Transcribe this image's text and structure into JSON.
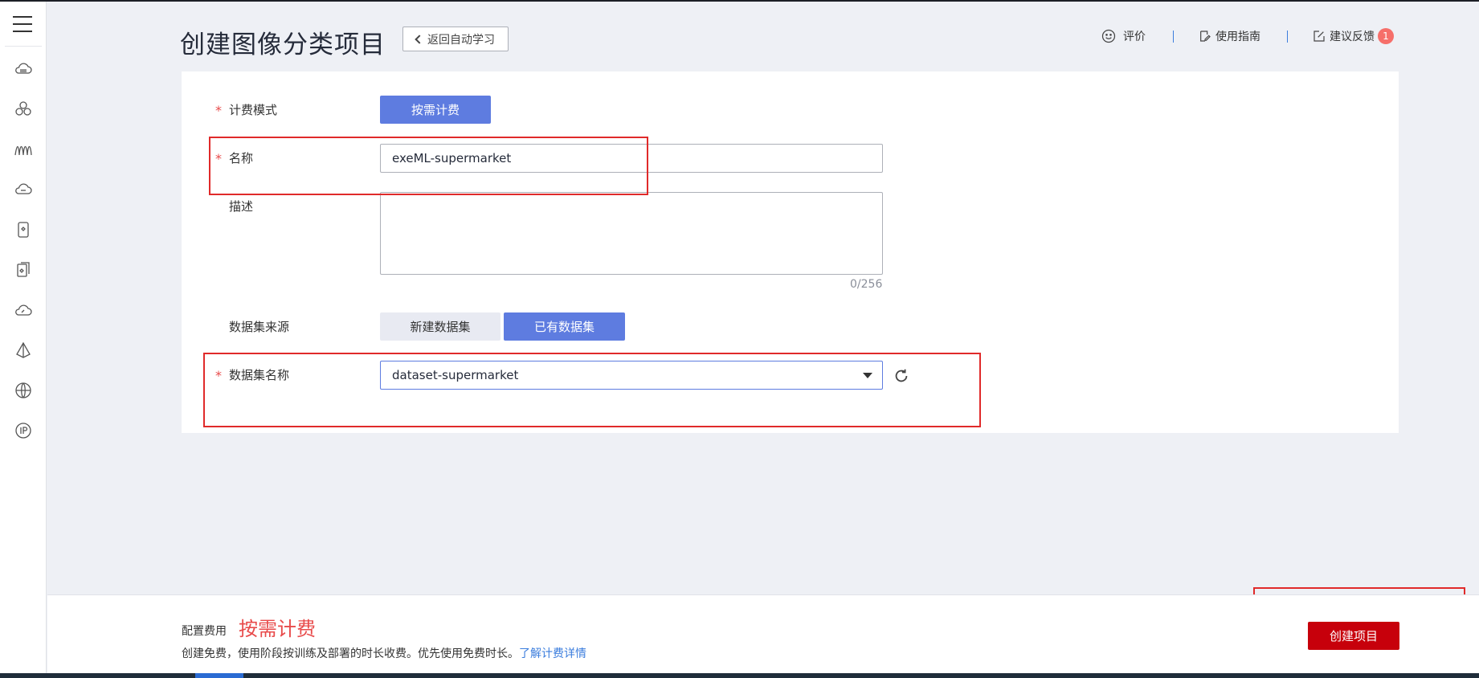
{
  "header": {
    "title": "创建图像分类项目",
    "back_label": "返回自动学习",
    "rating_label": "评价",
    "guide_label": "使用指南",
    "feedback_label": "建议反馈",
    "feedback_count": "1"
  },
  "form": {
    "billing": {
      "label": "计费模式",
      "option": "按需计费"
    },
    "name": {
      "label": "名称",
      "value": "exeML-supermarket"
    },
    "description": {
      "label": "描述",
      "value": "",
      "counter": "0/256"
    },
    "dataset_source": {
      "label": "数据集来源",
      "options": [
        "新建数据集",
        "已有数据集"
      ],
      "selected": "已有数据集"
    },
    "dataset_name": {
      "label": "数据集名称",
      "value": "dataset-supermarket"
    }
  },
  "footer": {
    "fee_label": "配置费用",
    "fee_value": "按需计费",
    "fee_desc": "创建免费，使用阶段按训练及部署的时长收费。优先使用免费时长。",
    "fee_link": "了解计费详情",
    "create_label": "创建项目"
  },
  "sidebar": {
    "icons": [
      "cloud-icon",
      "cluster-icon",
      "wave-icon",
      "database-icon",
      "device-icon",
      "docs-icon",
      "cloud-gauge-icon",
      "pyramid-icon",
      "globe-icon",
      "ip-icon"
    ]
  },
  "colors": {
    "primary": "#5e7ce0",
    "danger": "#c7000b",
    "highlight": "#e02a2a",
    "link": "#3b7ddd"
  }
}
